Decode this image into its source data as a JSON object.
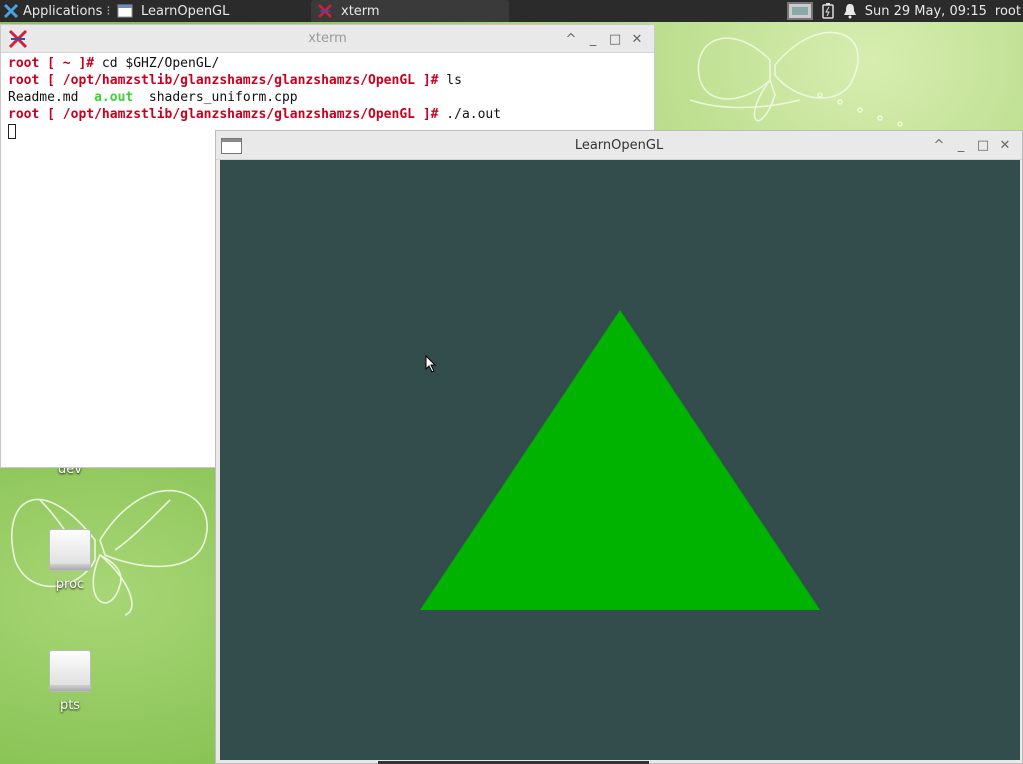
{
  "panel": {
    "applications_label": "Applications",
    "tasks": [
      {
        "label": "LearnOpenGL"
      },
      {
        "label": "xterm"
      }
    ],
    "clock": "Sun 29 May, 09:15",
    "user": "root",
    "icons": [
      "workspace-switcher-icon",
      "battery-icon",
      "notification-bell-icon"
    ]
  },
  "desktop": {
    "items": [
      {
        "label": "dev"
      },
      {
        "label": "proc"
      },
      {
        "label": "pts"
      }
    ]
  },
  "xterm": {
    "title": "xterm",
    "lines": [
      {
        "prompt": "root [ ~ ]#",
        "cmd": " cd $GHZ/OpenGL/"
      },
      {
        "prompt": "root [ /opt/hamzstlib/glanzshamzs/glanzshamzs/OpenGL ]#",
        "cmd": " ls"
      },
      {
        "files": [
          "Readme.md",
          "a.out",
          "shaders_uniform.cpp"
        ]
      },
      {
        "prompt": "root [ /opt/hamzstlib/glanzshamzs/glanzshamzs/OpenGL ]#",
        "cmd": " ./a.out"
      }
    ]
  },
  "glwindow": {
    "title": "LearnOpenGL",
    "clear_color": "#334d4d",
    "triangle_color": "#00b300"
  },
  "window_buttons": {
    "shade": "^",
    "minimize": "_",
    "maximize": "□",
    "close": "✕"
  }
}
